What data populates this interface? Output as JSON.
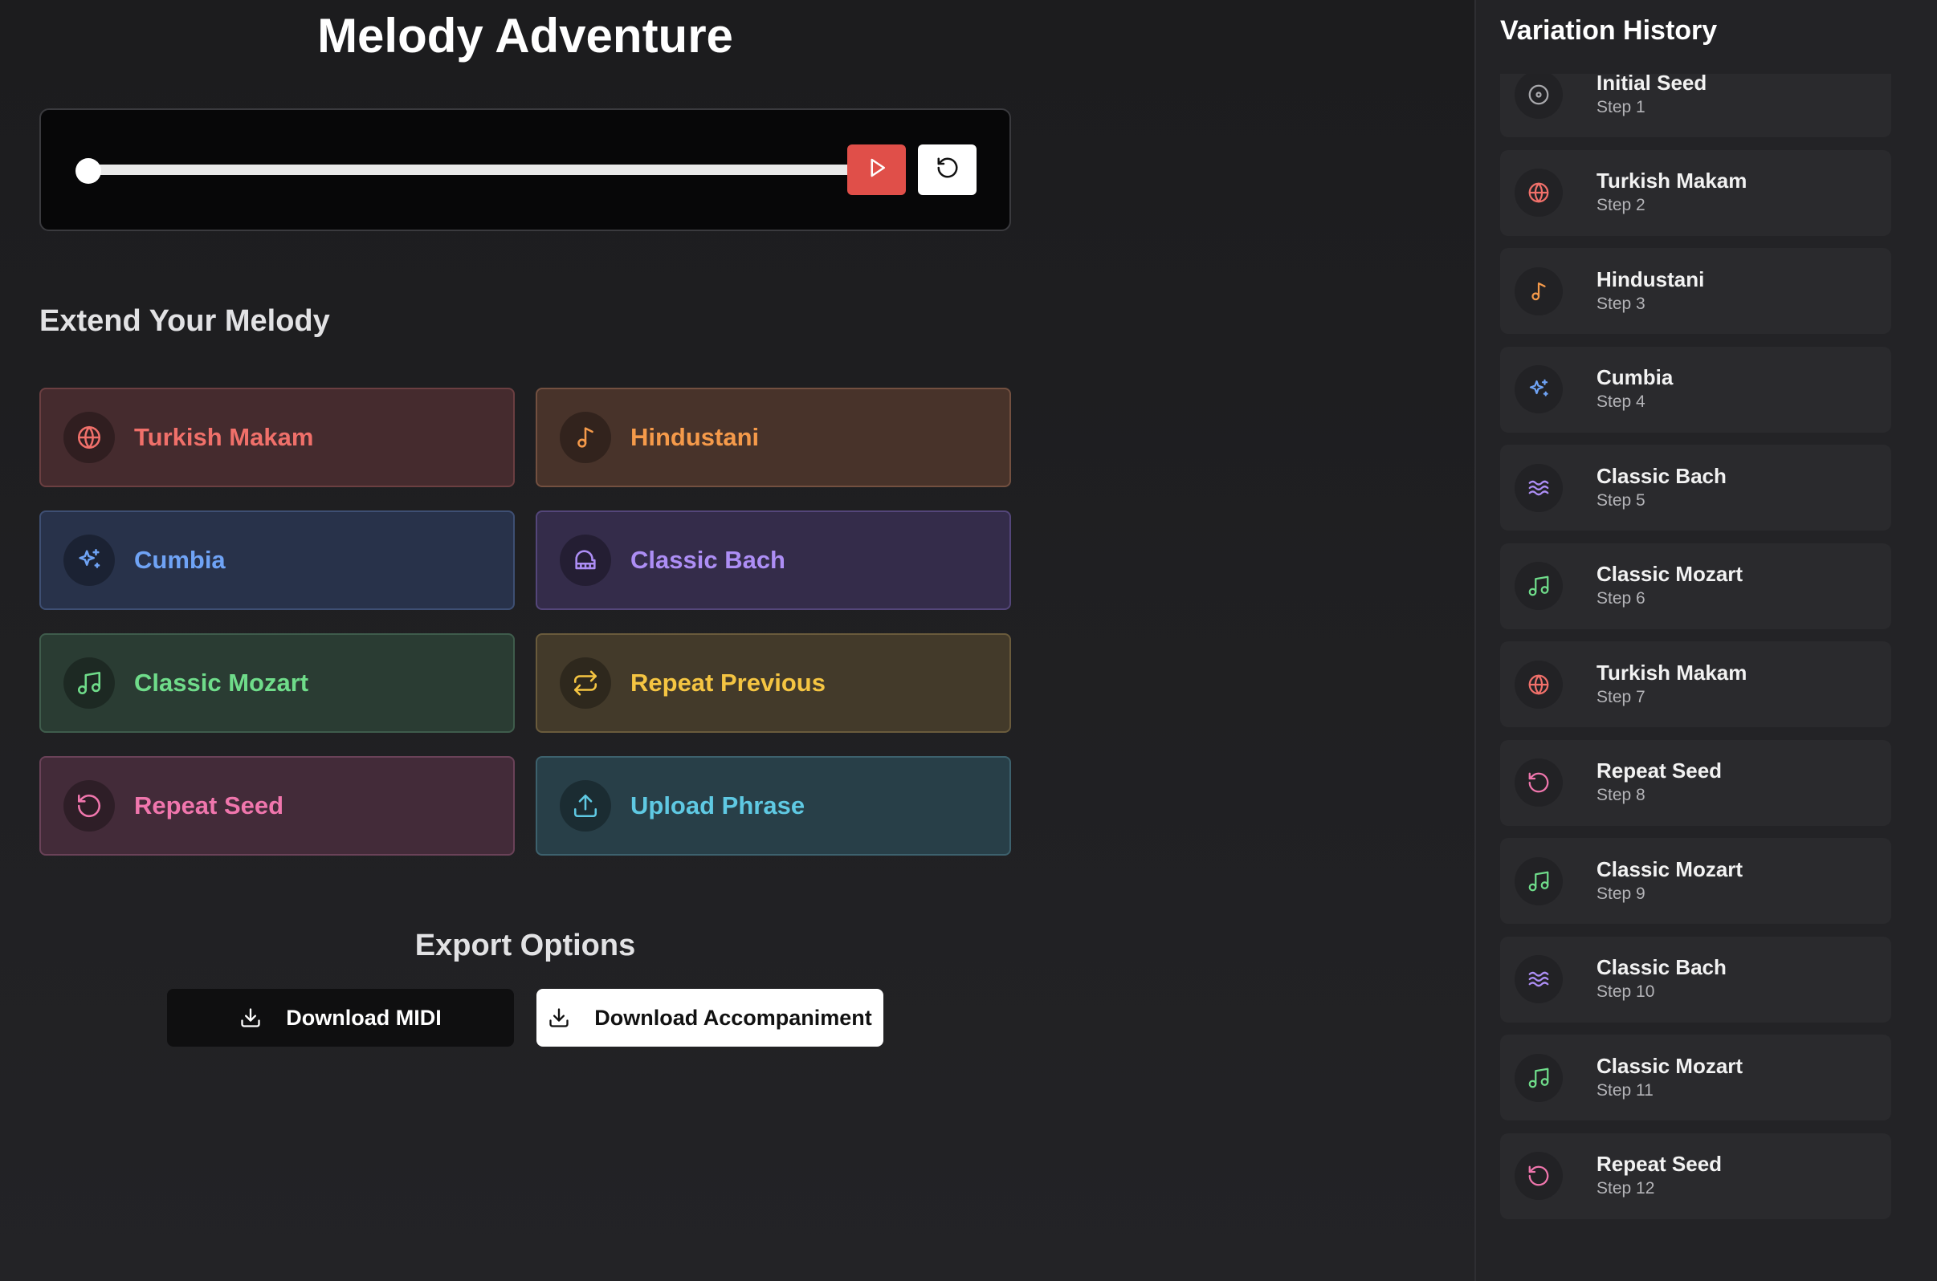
{
  "app": {
    "title": "Melody Adventure"
  },
  "player": {
    "progress": 0,
    "play_icon": "play-icon",
    "reset_icon": "rotate-ccw-icon"
  },
  "extend": {
    "title": "Extend Your Melody",
    "options": [
      {
        "label": "Turkish Makam",
        "icon": "globe-icon",
        "color": "#f0706a",
        "bg": "#452b2e",
        "border": "#6b3f41"
      },
      {
        "label": "Hindustani",
        "icon": "music-note-icon",
        "color": "#f59a4a",
        "bg": "#48332a",
        "border": "#735040"
      },
      {
        "label": "Cumbia",
        "icon": "sparkles-icon",
        "color": "#6fa3f5",
        "bg": "#28324a",
        "border": "#3e4f73"
      },
      {
        "label": "Classic Bach",
        "icon": "piano-icon",
        "color": "#ad8ef5",
        "bg": "#342c4a",
        "border": "#54467a"
      },
      {
        "label": "Classic Mozart",
        "icon": "music-notes-icon",
        "color": "#6fdc8a",
        "bg": "#2a3c33",
        "border": "#3f5c4c"
      },
      {
        "label": "Repeat Previous",
        "icon": "repeat-icon",
        "color": "#f5c542",
        "bg": "#433a2a",
        "border": "#6a5b3c"
      },
      {
        "label": "Repeat Seed",
        "icon": "rotate-ccw-icon",
        "color": "#f076ad",
        "bg": "#432b39",
        "border": "#6a4258"
      },
      {
        "label": "Upload Phrase",
        "icon": "upload-icon",
        "color": "#5fc9e3",
        "bg": "#283f48",
        "border": "#3d616d"
      }
    ]
  },
  "export": {
    "title": "Export Options",
    "midi_label": "Download MIDI",
    "accompaniment_label": "Download Accompaniment"
  },
  "history": {
    "title": "Variation History",
    "items": [
      {
        "name": "Initial Seed",
        "step": "Step 1",
        "icon": "disc-icon",
        "color": "#a8a8ac"
      },
      {
        "name": "Turkish Makam",
        "step": "Step 2",
        "icon": "globe-icon",
        "color": "#f0706a"
      },
      {
        "name": "Hindustani",
        "step": "Step 3",
        "icon": "music-note-icon",
        "color": "#f59a4a"
      },
      {
        "name": "Cumbia",
        "step": "Step 4",
        "icon": "sparkles-icon",
        "color": "#6fa3f5"
      },
      {
        "name": "Classic Bach",
        "step": "Step 5",
        "icon": "waves-icon",
        "color": "#ad8ef5"
      },
      {
        "name": "Classic Mozart",
        "step": "Step 6",
        "icon": "music-notes-icon",
        "color": "#6fdc8a"
      },
      {
        "name": "Turkish Makam",
        "step": "Step 7",
        "icon": "globe-icon",
        "color": "#f0706a"
      },
      {
        "name": "Repeat Seed",
        "step": "Step 8",
        "icon": "rotate-ccw-icon",
        "color": "#f076ad"
      },
      {
        "name": "Classic Mozart",
        "step": "Step 9",
        "icon": "music-notes-icon",
        "color": "#6fdc8a"
      },
      {
        "name": "Classic Bach",
        "step": "Step 10",
        "icon": "waves-icon",
        "color": "#ad8ef5"
      },
      {
        "name": "Classic Mozart",
        "step": "Step 11",
        "icon": "music-notes-icon",
        "color": "#6fdc8a"
      },
      {
        "name": "Repeat Seed",
        "step": "Step 12",
        "icon": "rotate-ccw-icon",
        "color": "#f076ad"
      }
    ]
  }
}
